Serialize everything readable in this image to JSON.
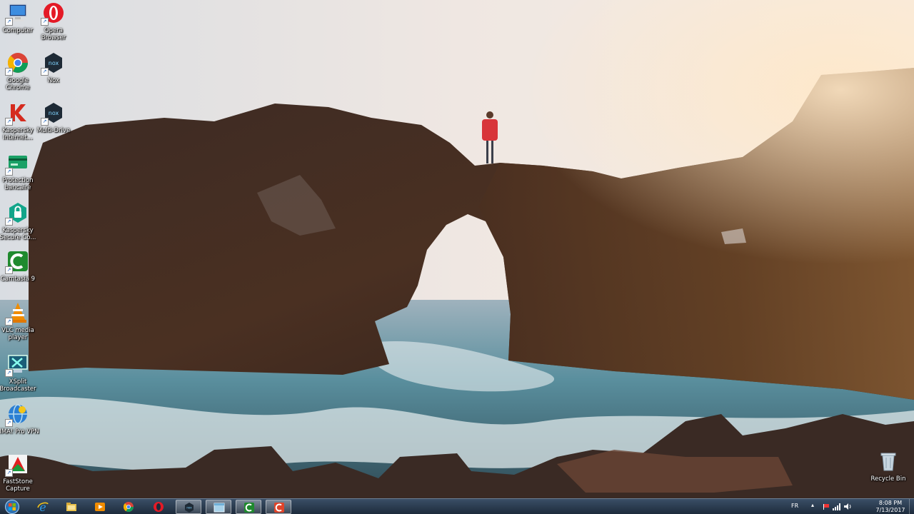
{
  "desktop": {
    "icons": [
      {
        "label": "Computer",
        "icon": "computer-icon"
      },
      {
        "label": "Opera Browser",
        "icon": "opera-icon"
      },
      {
        "label": "Google Chrome",
        "icon": "chrome-icon"
      },
      {
        "label": "Nox",
        "icon": "nox-icon"
      },
      {
        "label": "Kaspersky Internet...",
        "icon": "kaspersky-icon"
      },
      {
        "label": "Multi-Drive",
        "icon": "nox-multi-drive-icon"
      },
      {
        "label": "Protection bancaire",
        "icon": "bank-protection-icon"
      },
      {
        "label": "Kaspersky Secure Co...",
        "icon": "kaspersky-vpn-icon"
      },
      {
        "label": "Camtasia 9",
        "icon": "camtasia-icon"
      },
      {
        "label": "VLC media player",
        "icon": "vlc-icon"
      },
      {
        "label": "XSplit Broadcaster",
        "icon": "xsplit-icon"
      },
      {
        "label": "HMA! Pro VPN",
        "icon": "hma-icon"
      },
      {
        "label": "FastStone Capture",
        "icon": "faststone-icon"
      }
    ],
    "recycle_bin": {
      "label": "Recycle Bin"
    }
  },
  "taskbar": {
    "items": [
      {
        "icon": "internet-explorer-icon"
      },
      {
        "icon": "file-explorer-icon"
      },
      {
        "icon": "media-player-icon"
      },
      {
        "icon": "chrome-icon"
      },
      {
        "icon": "opera-icon"
      },
      {
        "icon": "nox-icon"
      },
      {
        "icon": "window-icon"
      },
      {
        "icon": "camtasia-icon"
      },
      {
        "icon": "camtasia-recorder-icon"
      }
    ],
    "tray": {
      "language": "FR"
    },
    "clock": {
      "time": "8:08 PM",
      "date": "7/13/2017"
    }
  },
  "colors": {
    "taskbar_top": "#3a4e66",
    "taskbar_bottom": "#1c2a3a",
    "sky": "#e9ddd6",
    "rock": "#4a3124",
    "sea": "#4d8596"
  }
}
